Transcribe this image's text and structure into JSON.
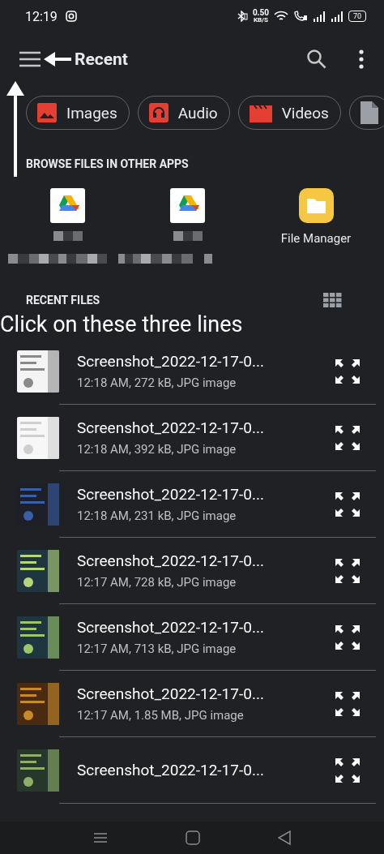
{
  "status_bar": {
    "time": "12:19",
    "speed": "0.50",
    "speed_unit": "KB/S",
    "battery": "70"
  },
  "app_bar": {
    "title": "Recent"
  },
  "chips": [
    {
      "label": "Images",
      "kind": "images"
    },
    {
      "label": "Audio",
      "kind": "audio"
    },
    {
      "label": "Videos",
      "kind": "videos"
    },
    {
      "kind": "documents"
    }
  ],
  "browse_section": {
    "title": "BROWSE FILES IN OTHER APPS",
    "apps": [
      {
        "kind": "drive"
      },
      {
        "kind": "drive"
      },
      {
        "kind": "file_manager",
        "label": "File Manager"
      }
    ]
  },
  "recent_section": {
    "title": "RECENT FILES"
  },
  "files": [
    {
      "title": "Screenshot_2022-12-17-0...",
      "meta": "12:18 AM, 272 kB, JPG image"
    },
    {
      "title": "Screenshot_2022-12-17-0...",
      "meta": "12:18 AM, 392 kB, JPG image"
    },
    {
      "title": "Screenshot_2022-12-17-0...",
      "meta": "12:18 AM, 231 kB, JPG image"
    },
    {
      "title": "Screenshot_2022-12-17-0...",
      "meta": "12:17 AM, 728 kB, JPG image"
    },
    {
      "title": "Screenshot_2022-12-17-0...",
      "meta": "12:17 AM, 713 kB, JPG image"
    },
    {
      "title": "Screenshot_2022-12-17-0...",
      "meta": "12:17 AM, 1.85 MB, JPG image"
    },
    {
      "title": "Screenshot_2022-12-17-0..."
    }
  ],
  "annotation": {
    "text": "Click on these three lines"
  }
}
